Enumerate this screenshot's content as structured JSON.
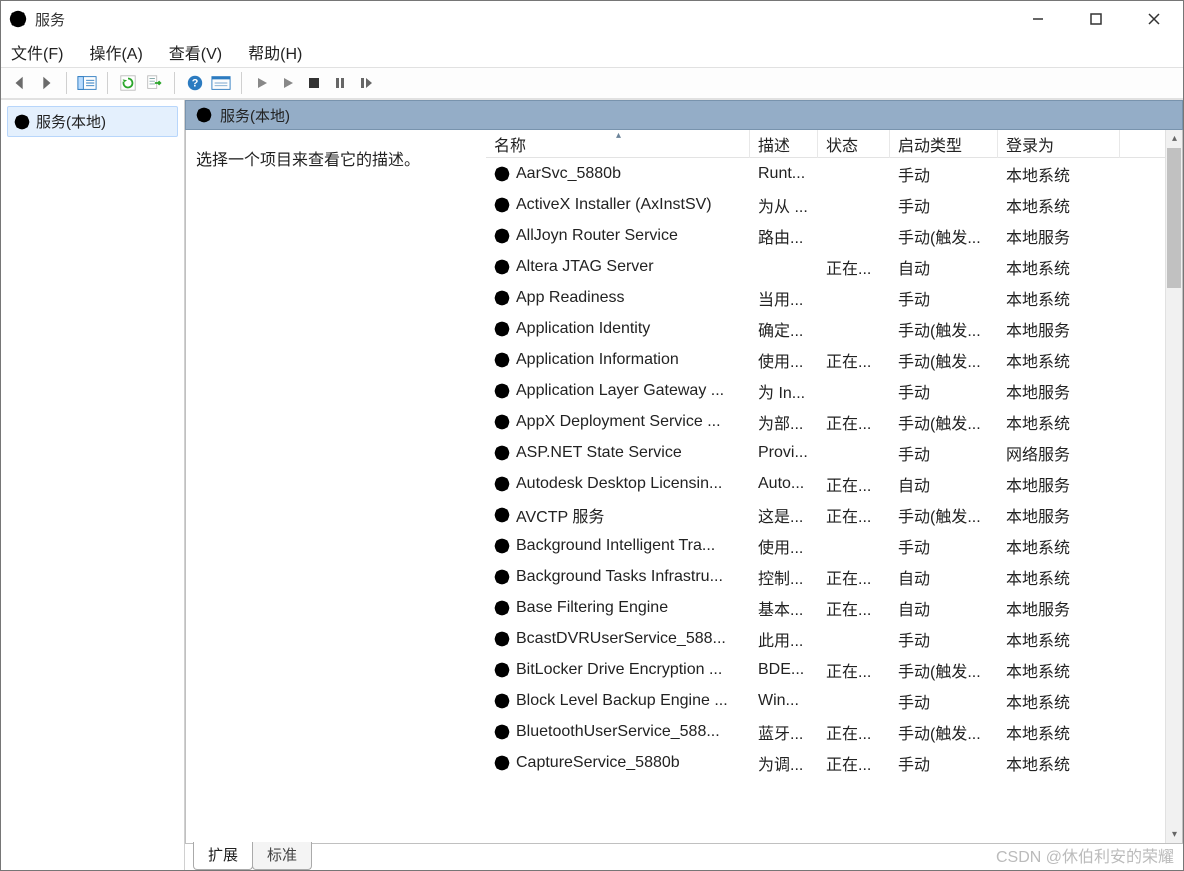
{
  "window": {
    "title": "服务"
  },
  "menu": {
    "file": "文件(F)",
    "action": "操作(A)",
    "view": "查看(V)",
    "help": "帮助(H)"
  },
  "tree": {
    "local": "服务(本地)"
  },
  "panel_header": "服务(本地)",
  "description_prompt": "选择一个项目来查看它的描述。",
  "columns": {
    "name": "名称",
    "description": "描述",
    "status": "状态",
    "startup_type": "启动类型",
    "login_as": "登录为"
  },
  "tabs": {
    "extended": "扩展",
    "standard": "标准"
  },
  "watermark": "CSDN @休伯利安的荣耀",
  "services": [
    {
      "name": "AarSvc_5880b",
      "description": "Runt...",
      "status": "",
      "startup": "手动",
      "login": "本地系统"
    },
    {
      "name": "ActiveX Installer (AxInstSV)",
      "description": "为从 ...",
      "status": "",
      "startup": "手动",
      "login": "本地系统"
    },
    {
      "name": "AllJoyn Router Service",
      "description": "路由...",
      "status": "",
      "startup": "手动(触发...",
      "login": "本地服务"
    },
    {
      "name": "Altera JTAG Server",
      "description": "",
      "status": "正在...",
      "startup": "自动",
      "login": "本地系统"
    },
    {
      "name": "App Readiness",
      "description": "当用...",
      "status": "",
      "startup": "手动",
      "login": "本地系统"
    },
    {
      "name": "Application Identity",
      "description": "确定...",
      "status": "",
      "startup": "手动(触发...",
      "login": "本地服务"
    },
    {
      "name": "Application Information",
      "description": "使用...",
      "status": "正在...",
      "startup": "手动(触发...",
      "login": "本地系统"
    },
    {
      "name": "Application Layer Gateway ...",
      "description": "为 In...",
      "status": "",
      "startup": "手动",
      "login": "本地服务"
    },
    {
      "name": "AppX Deployment Service ...",
      "description": "为部...",
      "status": "正在...",
      "startup": "手动(触发...",
      "login": "本地系统"
    },
    {
      "name": "ASP.NET State Service",
      "description": "Provi...",
      "status": "",
      "startup": "手动",
      "login": "网络服务"
    },
    {
      "name": "Autodesk Desktop Licensin...",
      "description": "Auto...",
      "status": "正在...",
      "startup": "自动",
      "login": "本地服务"
    },
    {
      "name": "AVCTP 服务",
      "description": "这是...",
      "status": "正在...",
      "startup": "手动(触发...",
      "login": "本地服务"
    },
    {
      "name": "Background Intelligent Tra...",
      "description": "使用...",
      "status": "",
      "startup": "手动",
      "login": "本地系统"
    },
    {
      "name": "Background Tasks Infrastru...",
      "description": "控制...",
      "status": "正在...",
      "startup": "自动",
      "login": "本地系统"
    },
    {
      "name": "Base Filtering Engine",
      "description": "基本...",
      "status": "正在...",
      "startup": "自动",
      "login": "本地服务"
    },
    {
      "name": "BcastDVRUserService_588...",
      "description": "此用...",
      "status": "",
      "startup": "手动",
      "login": "本地系统"
    },
    {
      "name": "BitLocker Drive Encryption ...",
      "description": "BDE...",
      "status": "正在...",
      "startup": "手动(触发...",
      "login": "本地系统"
    },
    {
      "name": "Block Level Backup Engine ...",
      "description": "Win...",
      "status": "",
      "startup": "手动",
      "login": "本地系统"
    },
    {
      "name": "BluetoothUserService_588...",
      "description": "蓝牙...",
      "status": "正在...",
      "startup": "手动(触发...",
      "login": "本地系统"
    },
    {
      "name": "CaptureService_5880b",
      "description": "为调...",
      "status": "正在...",
      "startup": "手动",
      "login": "本地系统"
    }
  ]
}
